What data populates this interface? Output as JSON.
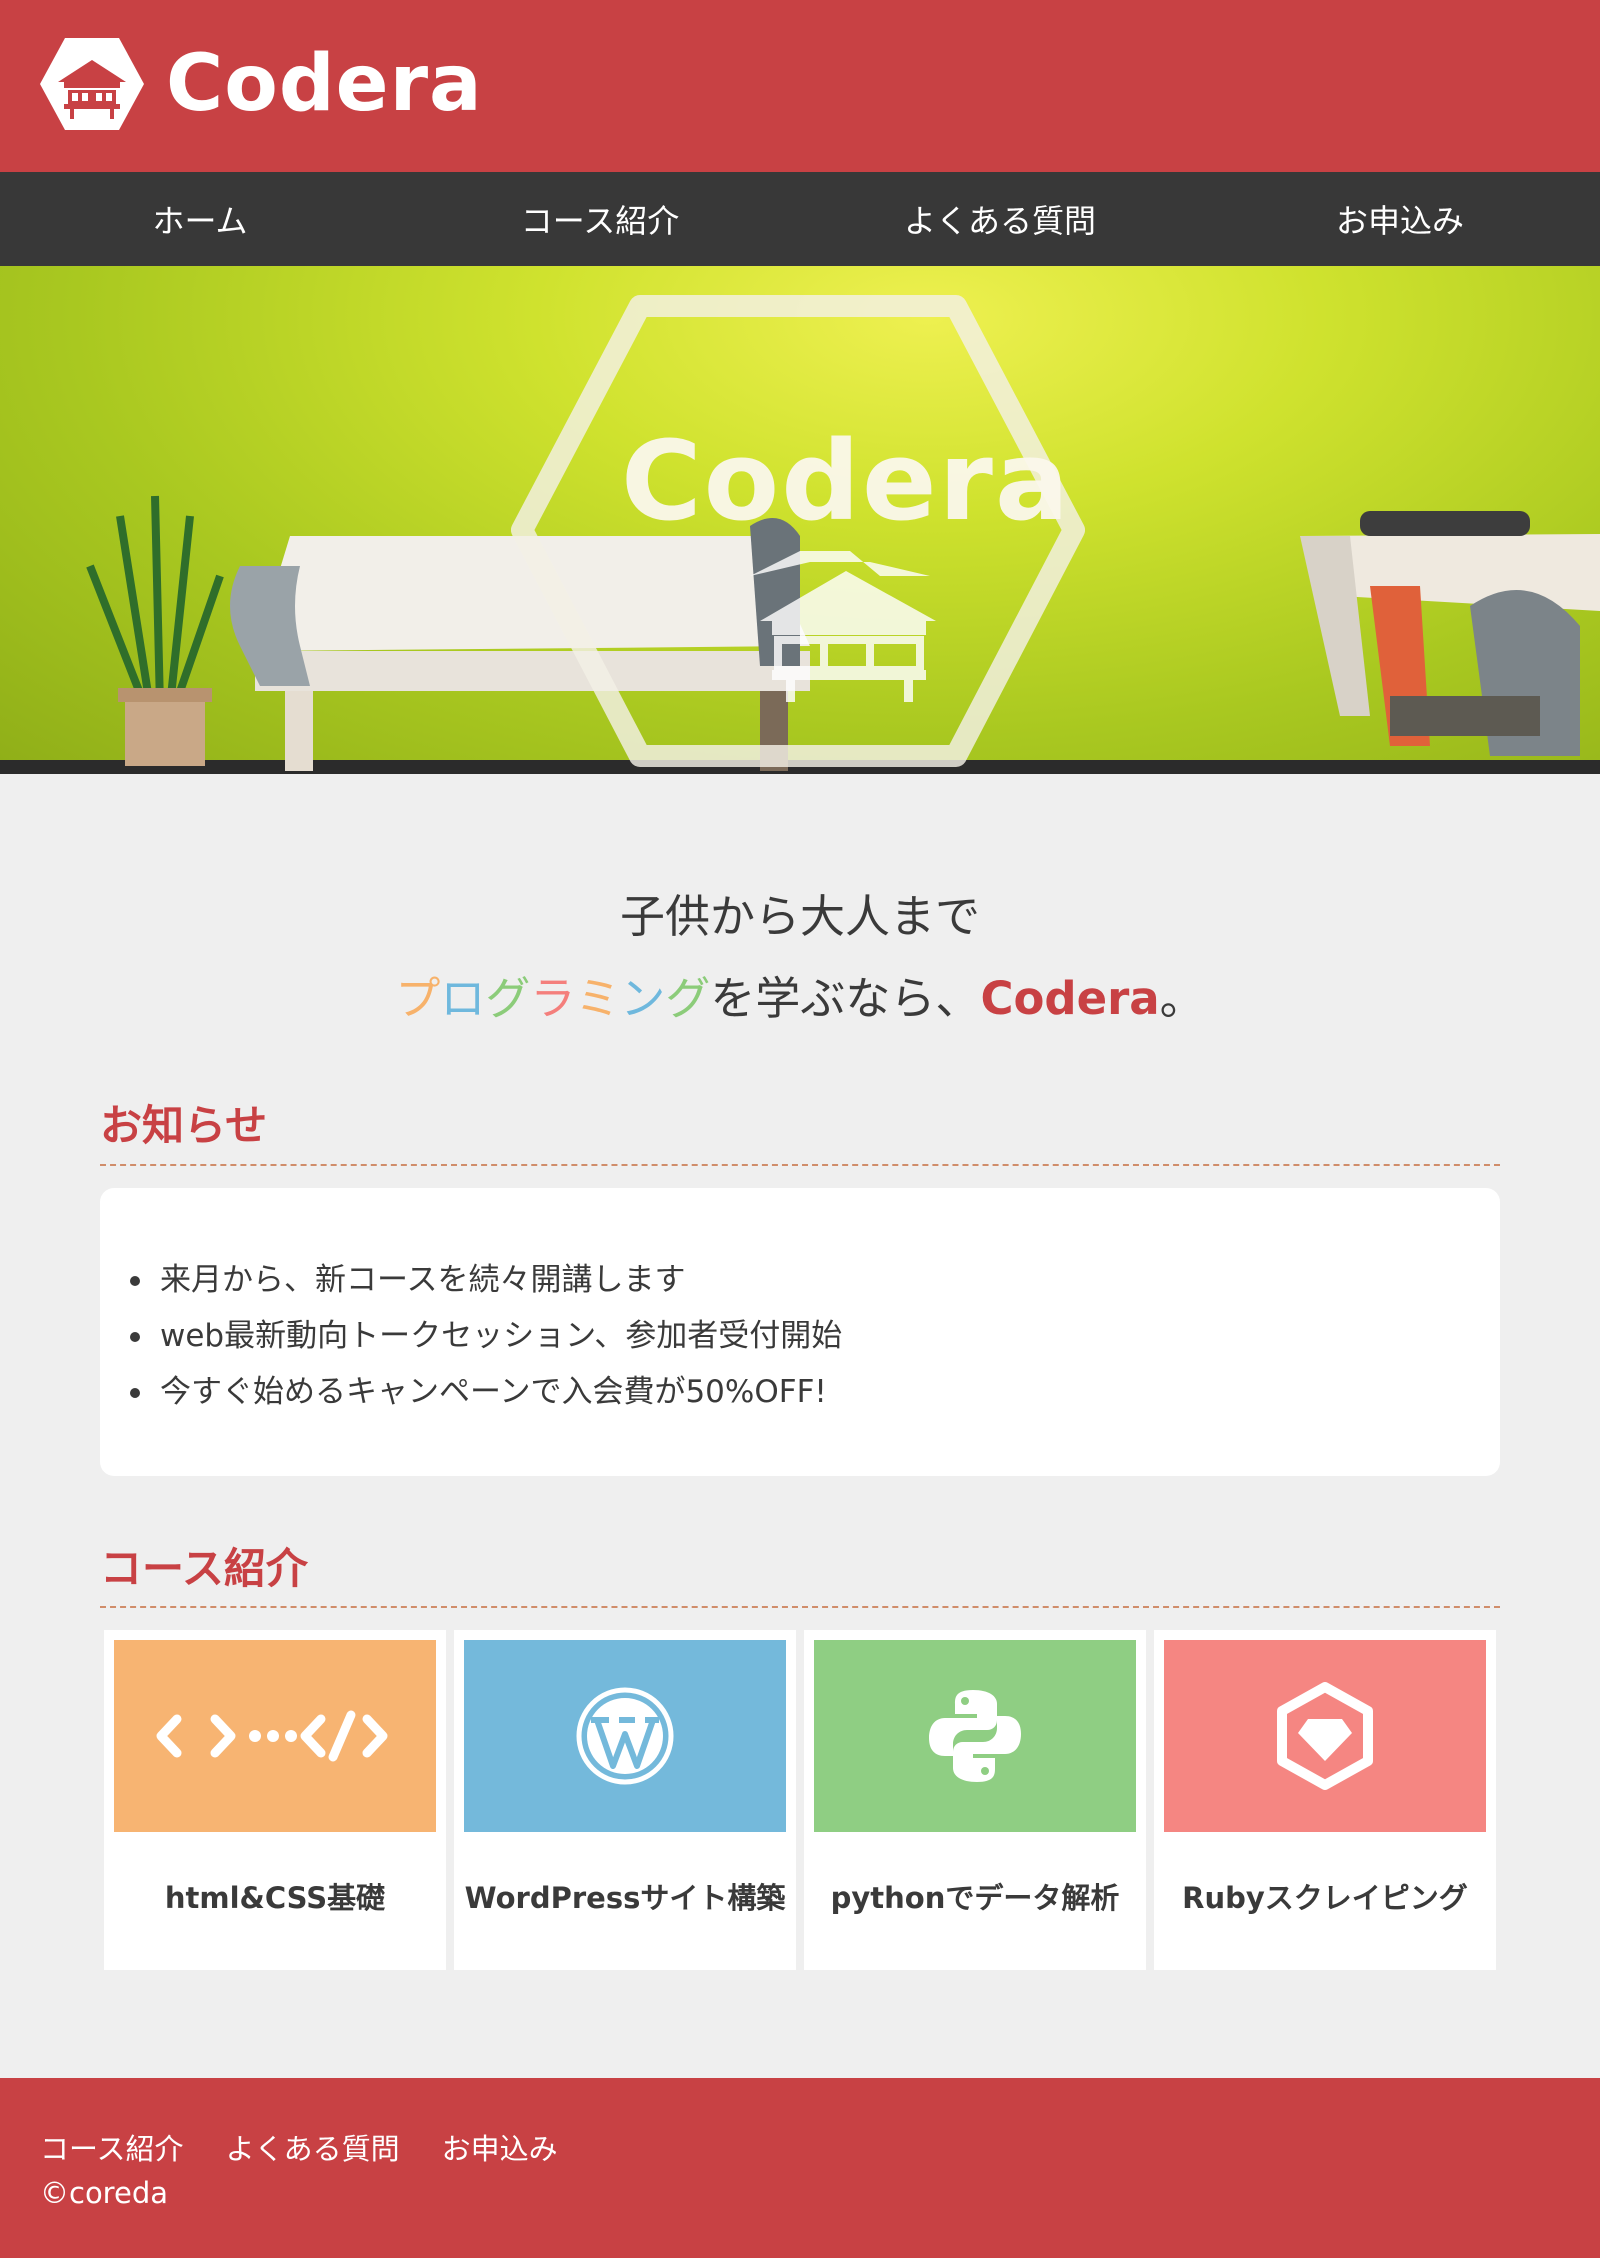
{
  "header": {
    "logo_text": "Codera"
  },
  "nav": [
    {
      "label": "ホーム"
    },
    {
      "label": "コース紹介"
    },
    {
      "label": "よくある質問"
    },
    {
      "label": "お申込み"
    }
  ],
  "hero": {
    "logo_text": "Codera"
  },
  "tagline": {
    "line1": "子供から大人まで",
    "prog_chars": [
      "プ",
      "ロ",
      "グ",
      "ラ",
      "ミ",
      "ン",
      "グ"
    ],
    "prog_colors": [
      "#f7b26b",
      "#6fb8dd",
      "#8ccc7a",
      "#f47f7c",
      "#f7b26b",
      "#6fb8dd",
      "#8ccc7a"
    ],
    "middle": "を学ぶなら、",
    "brand": "Codera",
    "end": "。"
  },
  "news": {
    "title": "お知らせ",
    "items": [
      "来月から、新コースを続々開講します",
      "web最新動向トークセッション、参加者受付開始",
      "今すぐ始めるキャンペーンで入会費が50%OFF!"
    ]
  },
  "courses": {
    "title": "コース紹介",
    "items": [
      {
        "label": "html&CSS基礎",
        "color": "#f7b472",
        "icon": "code-icon"
      },
      {
        "label": "WordPressサイト構築",
        "color": "#74b9db",
        "icon": "wordpress-icon"
      },
      {
        "label": "pythonでデータ解析",
        "color": "#8fce83",
        "icon": "python-icon"
      },
      {
        "label": "Rubyスクレイピング",
        "color": "#f58682",
        "icon": "ruby-icon"
      }
    ]
  },
  "footer": {
    "links": [
      "コース紹介",
      "よくある質問",
      "お申込み"
    ],
    "copyright": "©coreda"
  },
  "colors": {
    "brand": "#c84144",
    "nav_bg": "#383838",
    "page_bg": "#efefef"
  }
}
